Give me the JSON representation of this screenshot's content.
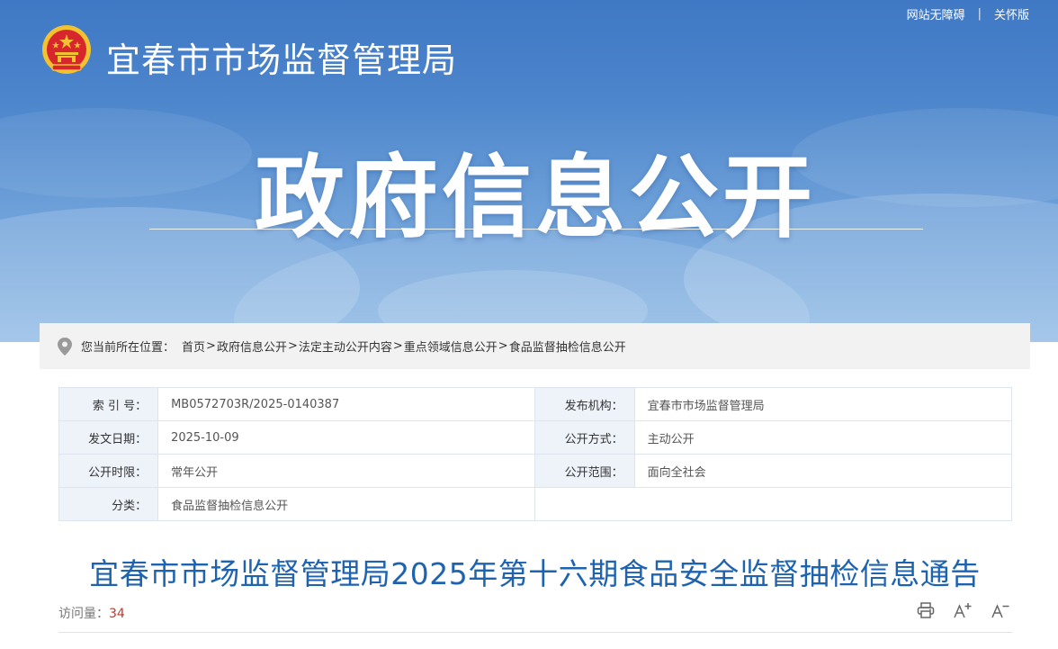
{
  "header": {
    "site_name": "宜春市市场监督管理局",
    "hero_title": "政府信息公开",
    "top_links": [
      "网站无障碍",
      "关怀版"
    ]
  },
  "breadcrumb": {
    "prefix": "您当前所在位置：",
    "items": [
      "首页",
      "政府信息公开",
      "法定主动公开内容",
      "重点领域信息公开",
      "食品监督抽检信息公开"
    ]
  },
  "meta": {
    "rows": [
      {
        "label1": "索 引 号：",
        "value1": "MB0572703R/2025-0140387",
        "label2": "发布机构：",
        "value2": "宜春市市场监督管理局"
      },
      {
        "label1": "发文日期：",
        "value1": "2025-10-09",
        "label2": "公开方式：",
        "value2": "主动公开"
      },
      {
        "label1": "公开时限：",
        "value1": "常年公开",
        "label2": "公开范围：",
        "value2": "面向全社会"
      },
      {
        "label1": "分类：",
        "value1": "食品监督抽检信息公开",
        "label2": "",
        "value2": ""
      }
    ]
  },
  "article": {
    "title": "宜春市市场监督管理局2025年第十六期食品安全监督抽检信息通告",
    "visits_label": "访问量：",
    "visits_count": "34"
  },
  "tools": {
    "print_icon": "printer-icon",
    "font_increase_icon": "font-increase-icon",
    "font_decrease_icon": "font-decrease-icon"
  },
  "colors": {
    "banner_top": "#3f78c4",
    "title_blue": "#1e63b0",
    "visit_red": "#c0392b",
    "label_bg": "#eef3fa"
  }
}
